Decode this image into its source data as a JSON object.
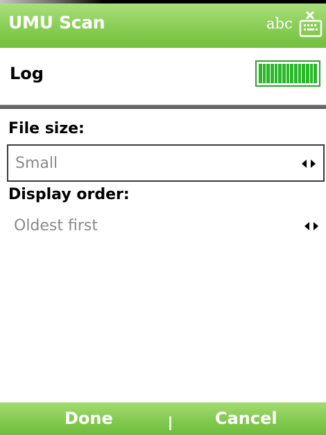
{
  "title_bar": {
    "app_title": "UMU Scan",
    "input_mode": "abc",
    "ime_icon": "keyboard-input-icon"
  },
  "header": {
    "title": "Log",
    "signal_icon": "signal-strength-icon"
  },
  "fields": [
    {
      "label": "File size:",
      "value": "Small",
      "focused": true
    },
    {
      "label": "Display order:",
      "value": "Oldest first",
      "focused": false
    }
  ],
  "softkeys": {
    "left": "Done",
    "right": "Cancel"
  },
  "colors": {
    "bar_green": "#86cb53",
    "signal_green": "#29b829",
    "value_gray": "#8a8a8a"
  }
}
